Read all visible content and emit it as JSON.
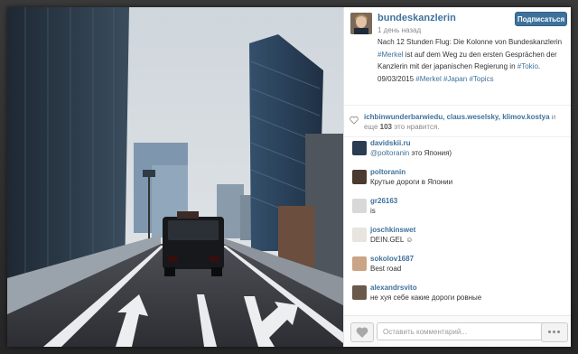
{
  "post": {
    "username": "bundeskanzlerin",
    "time": "1 день назад",
    "follow_label": "Подписаться",
    "caption_parts": [
      {
        "text": "Nach 12 Stunden Flug: Die Kolonne von Bundeskanzlerin ",
        "tag": false
      },
      {
        "text": "#Merkel",
        "tag": true
      },
      {
        "text": " ist auf dem Weg zu den ersten Gesprächen der Kanzlerin mit der japanischen Regierung in ",
        "tag": false
      },
      {
        "text": "#Tokio",
        "tag": true
      },
      {
        "text": ". 09/03/2015 ",
        "tag": false
      },
      {
        "text": "#Merkel",
        "tag": true
      },
      {
        "text": " ",
        "tag": false
      },
      {
        "text": "#Japan",
        "tag": true
      },
      {
        "text": " ",
        "tag": false
      },
      {
        "text": "#Topics",
        "tag": true
      }
    ]
  },
  "likes": {
    "users": "ichbinwunderbarwiedu, claus.weselsky, klimov.kostya",
    "prefix": " и",
    "more": "еще ",
    "count": "103",
    "suffix": " это нравится."
  },
  "comments": [
    {
      "user": "davidskii.ru",
      "mention": "@poltoranin",
      "text": " это Япония)",
      "avatar_color": "#2b3b52"
    },
    {
      "user": "poltoranin",
      "mention": "",
      "text": "Крутые дороги в Японии",
      "avatar_color": "#4a3a30"
    },
    {
      "user": "gr26163",
      "mention": "",
      "text": "is",
      "avatar_color": "#d8d8d8"
    },
    {
      "user": "joschkinswet",
      "mention": "",
      "text": "DEIN.GEL ☺",
      "avatar_color": "#e8e4e0"
    },
    {
      "user": "sokolov1687",
      "mention": "",
      "text": "Best road",
      "avatar_color": "#c9a586"
    },
    {
      "user": "alexandrsvito",
      "mention": "",
      "text": "не хуя себе какие дороги ровные",
      "avatar_color": "#6a5a4c"
    }
  ],
  "footer": {
    "comment_placeholder": "Оставить комментарий..."
  },
  "icons": {
    "like_small": "heart-icon",
    "like_button": "heart-icon",
    "more_button": "ellipsis-icon"
  },
  "colors": {
    "accent": "#3f729b",
    "muted": "#8a8a8a"
  }
}
